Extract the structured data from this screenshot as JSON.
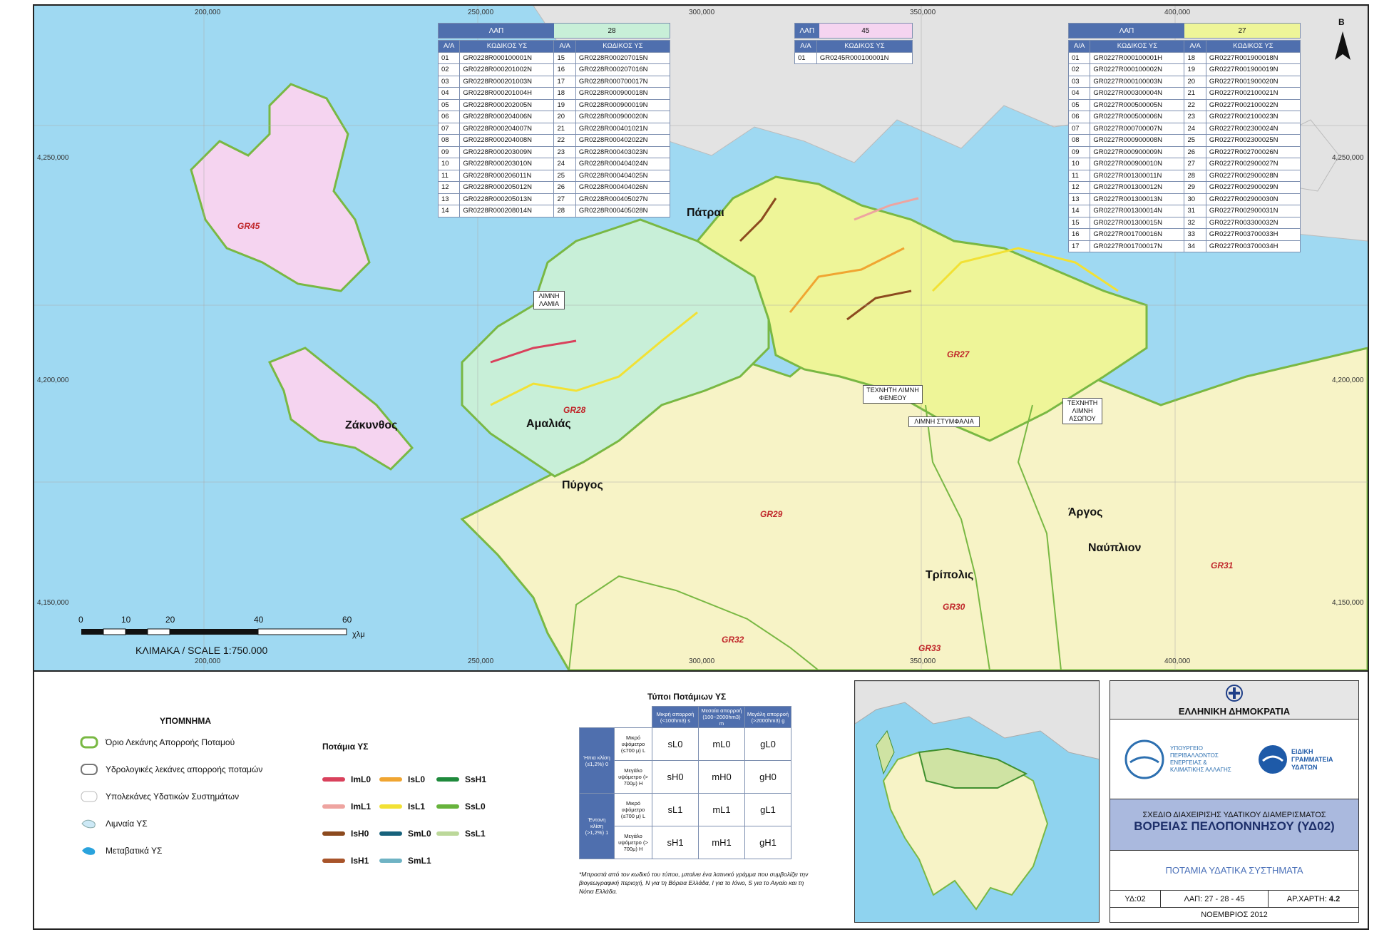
{
  "map": {
    "x_ticks_top": [
      "200,000",
      "250,000",
      "300,000",
      "350,000",
      "400,000"
    ],
    "x_ticks_bottom": [
      "200,000",
      "250,000",
      "300,000",
      "350,000",
      "400,000"
    ],
    "y_ticks": [
      "4,250,000",
      "4,200,000",
      "4,150,000"
    ],
    "north": "B",
    "places": {
      "patrai": "Πάτραι",
      "amalias": "Αμαλιάς",
      "pyrgos": "Πύργος",
      "zakynthos": "Ζάκυνθος",
      "argos": "Άργος",
      "nafplion": "Ναύπλιον",
      "tripolis": "Τρίπολις"
    },
    "codes": {
      "gr45": "GR45",
      "gr28": "GR28",
      "gr27": "GR27",
      "gr29": "GR29",
      "gr30": "GR30",
      "gr31": "GR31",
      "gr32": "GR32",
      "gr33": "GR33"
    },
    "boxes": {
      "limni_lamia": "ΛΙΜΝΗ ΛΑΜΙΑ",
      "feneou": "ΤΕΧΝΗΤΗ ΛΙΜΝΗ ΦΕΝΕΟΥ",
      "stymfalia": "ΛΙΜΝΗ ΣΤΥΜΦΑΛΙΑ",
      "asopou": "ΤΕΧΝΗΤΗ ΛΙΜΝΗ ΑΣΩΠΟΥ"
    },
    "scale": {
      "ticks": [
        "0",
        "10",
        "20",
        "40",
        "60"
      ],
      "unit": "χλμ",
      "label": "ΚΛΙΜΑΚΑ / SCALE 1:750.000"
    }
  },
  "tables": {
    "lap_label": "ΛΑΠ",
    "col_aa": "Α/Α",
    "col_code": "ΚΩΔΙΚΟΣ ΥΣ",
    "t28": {
      "lap": "28",
      "rows": [
        [
          "01",
          "GR0228R000100001N",
          "15",
          "GR0228R000207015N"
        ],
        [
          "02",
          "GR0228R000201002N",
          "16",
          "GR0228R000207016N"
        ],
        [
          "03",
          "GR0228R000201003N",
          "17",
          "GR0228R000700017N"
        ],
        [
          "04",
          "GR0228R000201004H",
          "18",
          "GR0228R000900018N"
        ],
        [
          "05",
          "GR0228R000202005N",
          "19",
          "GR0228R000900019N"
        ],
        [
          "06",
          "GR0228R000204006N",
          "20",
          "GR0228R000900020N"
        ],
        [
          "07",
          "GR0228R000204007N",
          "21",
          "GR0228R000401021N"
        ],
        [
          "08",
          "GR0228R000204008N",
          "22",
          "GR0228R000402022N"
        ],
        [
          "09",
          "GR0228R000203009N",
          "23",
          "GR0228R000403023N"
        ],
        [
          "10",
          "GR0228R000203010N",
          "24",
          "GR0228R000404024N"
        ],
        [
          "11",
          "GR0228R000206011N",
          "25",
          "GR0228R000404025N"
        ],
        [
          "12",
          "GR0228R000205012N",
          "26",
          "GR0228R000404026N"
        ],
        [
          "13",
          "GR0228R000205013N",
          "27",
          "GR0228R000405027N"
        ],
        [
          "14",
          "GR0228R000208014N",
          "28",
          "GR0228R000405028N"
        ]
      ]
    },
    "t45": {
      "lap": "45",
      "rows": [
        [
          "01",
          "GR0245R000100001N"
        ]
      ]
    },
    "t27": {
      "lap": "27",
      "rows": [
        [
          "01",
          "GR0227R000100001H",
          "18",
          "GR0227R001900018N"
        ],
        [
          "02",
          "GR0227R000100002N",
          "19",
          "GR0227R001900019N"
        ],
        [
          "03",
          "GR0227R000100003N",
          "20",
          "GR0227R001900020N"
        ],
        [
          "04",
          "GR0227R000300004N",
          "21",
          "GR0227R002100021N"
        ],
        [
          "05",
          "GR0227R000500005N",
          "22",
          "GR0227R002100022N"
        ],
        [
          "06",
          "GR0227R000500006N",
          "23",
          "GR0227R002100023N"
        ],
        [
          "07",
          "GR0227R000700007N",
          "24",
          "GR0227R002300024N"
        ],
        [
          "08",
          "GR0227R000900008N",
          "25",
          "GR0227R002300025N"
        ],
        [
          "09",
          "GR0227R000900009N",
          "26",
          "GR0227R002700026N"
        ],
        [
          "10",
          "GR0227R000900010N",
          "27",
          "GR0227R002900027N"
        ],
        [
          "11",
          "GR0227R001300011N",
          "28",
          "GR0227R002900028N"
        ],
        [
          "12",
          "GR0227R001300012N",
          "29",
          "GR0227R002900029N"
        ],
        [
          "13",
          "GR0227R001300013N",
          "30",
          "GR0227R002900030N"
        ],
        [
          "14",
          "GR0227R001300014N",
          "31",
          "GR0227R002900031N"
        ],
        [
          "15",
          "GR0227R001300015N",
          "32",
          "GR0227R003300032N"
        ],
        [
          "16",
          "GR0227R001700016N",
          "33",
          "GR0227R003700033H"
        ],
        [
          "17",
          "GR0227R001700017N",
          "34",
          "GR0227R003700034H"
        ]
      ]
    }
  },
  "legend": {
    "title": "ΥΠΟΜΝΗΜΑ",
    "items": [
      "Όριο Λεκάνης Απορροής Ποταμού",
      "Υδρολογικές λεκάνες απορροής ποταμών",
      "Υπολεκάνες Υδατικών Συστημάτων",
      "Λιμναία ΥΣ",
      "Μεταβατικά ΥΣ"
    ],
    "rivers_title": "Ποτάμια ΥΣ",
    "rivers": [
      {
        "code": "ImL0",
        "color": "#d9415c"
      },
      {
        "code": "IsL0",
        "color": "#f0a531"
      },
      {
        "code": "SsH1",
        "color": "#1f8a3c"
      },
      {
        "code": "ImL1",
        "color": "#eea4a0"
      },
      {
        "code": "IsL1",
        "color": "#f2e134"
      },
      {
        "code": "SsL0",
        "color": "#67b33c"
      },
      {
        "code": "IsH0",
        "color": "#8c4a1e"
      },
      {
        "code": "SmL0",
        "color": "#17627c"
      },
      {
        "code": "SsL1",
        "color": "#bcd89a"
      },
      {
        "code": "IsH1",
        "color": "#a8542a"
      },
      {
        "code": "SmL1",
        "color": "#6fb3c4"
      }
    ]
  },
  "types": {
    "title": "Τύποι Ποτάμιων ΥΣ",
    "cols": [
      "Μικρή απορροή (<100hm3) s",
      "Μεσαία απορροή (100~2000hm3) m",
      "Μεγάλη απορροή (>2000hm3) g"
    ],
    "groups": [
      "Ήπια κλίση (≤1,2%) 0",
      "Έντονη κλίση (>1,2%) 1"
    ],
    "subs": [
      "Μικρό υψόμετρο (≤700 μ) L",
      "Μεγάλο υψόμετρο (> 700μ) H"
    ],
    "cells": [
      [
        "sL0",
        "mL0",
        "gL0"
      ],
      [
        "sH0",
        "mH0",
        "gH0"
      ],
      [
        "sL1",
        "mL1",
        "gL1"
      ],
      [
        "sH1",
        "mH1",
        "gH1"
      ]
    ],
    "note": "*Μπροστά από τον κωδικό του τύπου, μπαίνει ένα λατινικό γράμμα που συμβολίζει την βιογεωγραφική περιοχή, Ν για τη Βόρεια Ελλάδα, Ι για το Ιόνιο, S για το Αιγαίο και τη Νότια Ελλάδα."
  },
  "title_block": {
    "republic": "ΕΛΛΗΝΙΚΗ ΔΗΜΟΚΡΑΤΙΑ",
    "ministry": "ΥΠΟΥΡΓΕΙΟ ΠΕΡΙΒΑΛΛΟΝΤΟΣ ΕΝΕΡΓΕΙΑΣ & ΚΛΙΜΑΤΙΚΗΣ ΑΛΛΑΓΗΣ",
    "secretariat": "ΕΙΔΙΚΗ ΓΡΑΜΜΑΤΕΙΑ ΥΔΑΤΩΝ",
    "plan": "ΣΧΕΔΙΟ ΔΙΑΧΕΙΡΙΣΗΣ ΥΔΑΤΙΚΟΥ ΔΙΑΜΕΡΙΣΜΑΤΟΣ",
    "region": "ΒΟΡΕΙΑΣ ΠΕΛΟΠΟΝΝΗΣΟΥ (ΥΔ02)",
    "map_title": "ΠΟΤΑΜΙΑ ΥΔΑΤΙΚΑ ΣΥΣΤΗΜΑΤΑ",
    "yd": "ΥΔ:02",
    "lap": "ΛΑΠ: 27 - 28 - 45",
    "map_no_label": "ΑΡ.ΧΑΡΤΗ:",
    "map_no": "4.2",
    "date": "ΝΟΕΜΒΡΙΟΣ 2012"
  },
  "colors": {
    "sea": "#9fd9f2",
    "land_gr29": "#f7f3c6",
    "gr27": "#eef598",
    "gr28": "#c8efd8",
    "gr45": "#f5d4f0",
    "gray_land": "#e3e3e3",
    "boundary": "#79b843",
    "header_blue": "#4f6fae"
  }
}
